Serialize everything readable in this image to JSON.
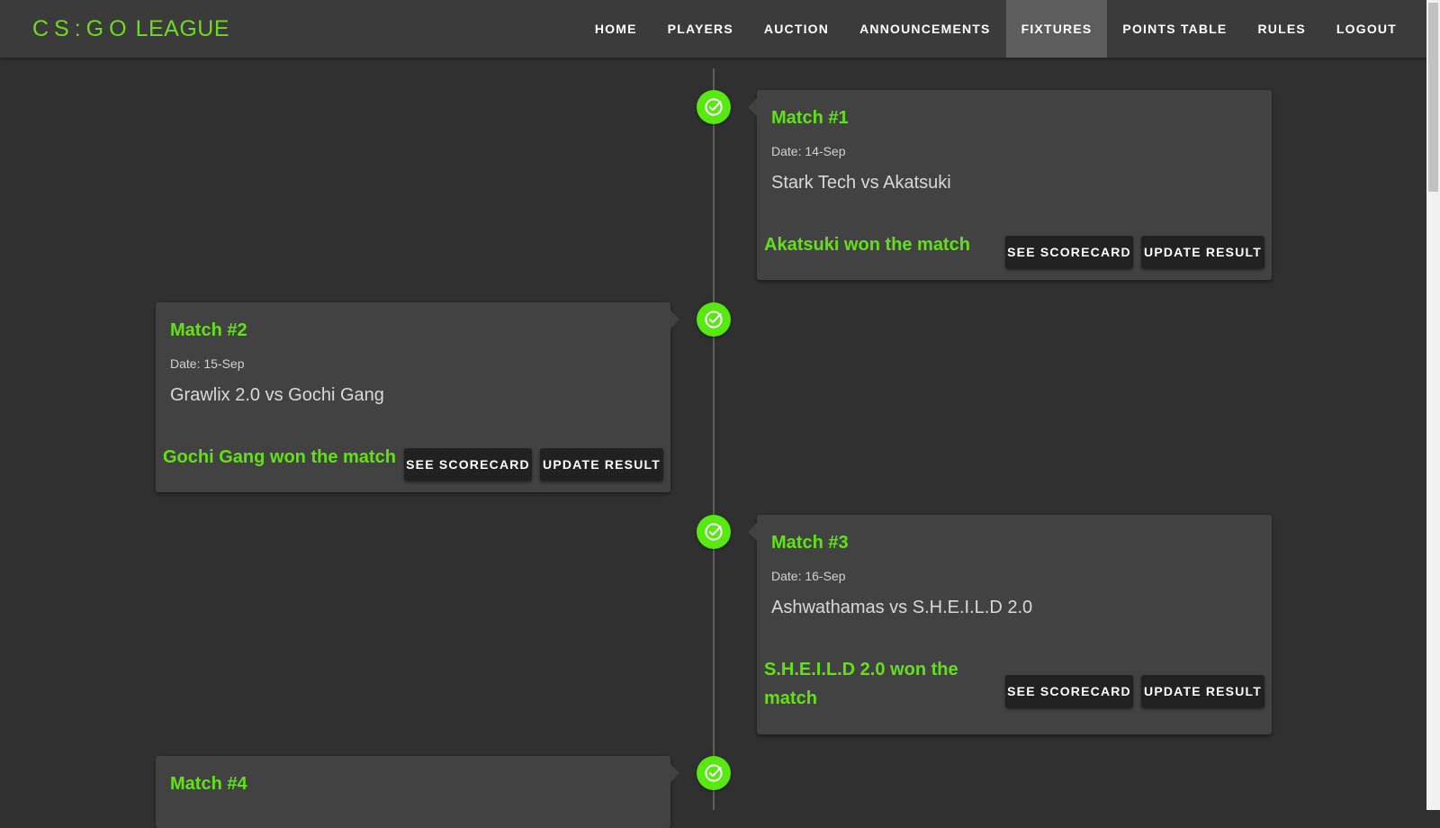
{
  "brand": {
    "part1": "CS:GO",
    "part2": "LEAGUE",
    "color": "#6fdb1c"
  },
  "nav": {
    "items": [
      {
        "label": "HOME"
      },
      {
        "label": "PLAYERS"
      },
      {
        "label": "AUCTION"
      },
      {
        "label": "ANNOUNCEMENTS"
      },
      {
        "label": "FIXTURES",
        "active": true
      },
      {
        "label": "POINTS TABLE"
      },
      {
        "label": "RULES"
      },
      {
        "label": "LOGOUT"
      }
    ]
  },
  "timeline": {
    "dot_icon": "check-circle-icon",
    "accent": "#58e812"
  },
  "matches": [
    {
      "title": "Match #1",
      "date": "Date: 14-Sep",
      "teams": "Stark Tech vs Akatsuki",
      "result": "Akatsuki won the match",
      "see_scorecard": "SEE SCORECARD",
      "update_result": "UPDATE RESULT"
    },
    {
      "title": "Match #2",
      "date": "Date: 15-Sep",
      "teams": "Grawlix 2.0 vs Gochi Gang",
      "result": "Gochi Gang won the match",
      "see_scorecard": "SEE SCORECARD",
      "update_result": "UPDATE RESULT"
    },
    {
      "title": "Match #3",
      "date": "Date: 16-Sep",
      "teams": "Ashwathamas vs S.H.E.I.L.D 2.0",
      "result": "S.H.E.I.L.D 2.0 won the match",
      "see_scorecard": "SEE SCORECARD",
      "update_result": "UPDATE RESULT"
    },
    {
      "title": "Match #4"
    }
  ]
}
